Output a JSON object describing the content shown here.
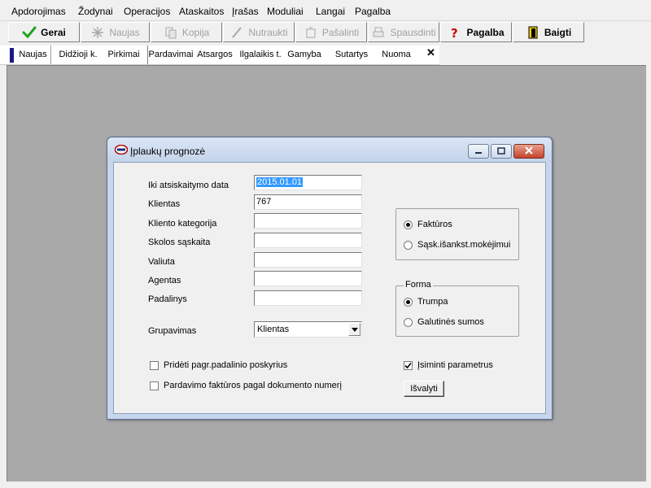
{
  "menu": {
    "items": [
      "Apdorojimas",
      "Žodynai",
      "Operacijos",
      "Ataskaitos",
      "Įrašas",
      "Moduliai",
      "Langai",
      "Pagalba"
    ]
  },
  "toolbar": {
    "buttons": [
      {
        "label": "Gerai",
        "icon": "check-icon",
        "enabled": true
      },
      {
        "label": "Naujas",
        "icon": "sparkle-icon",
        "enabled": false
      },
      {
        "label": "Kopija",
        "icon": "copy-icon",
        "enabled": false
      },
      {
        "label": "Nutraukti",
        "icon": "cancel-icon",
        "enabled": false
      },
      {
        "label": "Pašalinti",
        "icon": "delete-icon",
        "enabled": false
      },
      {
        "label": "Spausdinti",
        "icon": "print-icon",
        "enabled": false
      },
      {
        "label": "Pagalba",
        "icon": "help-icon",
        "enabled": true
      },
      {
        "label": "Baigti",
        "icon": "exit-door-icon",
        "enabled": true
      }
    ]
  },
  "tabs": {
    "items": [
      "Naujas",
      "Didžioji k.",
      "Pirkimai",
      "Pardavimai",
      "Atsargos",
      "Ilgalaikis t.",
      "Gamyba",
      "Sutartys",
      "Nuoma"
    ],
    "active": "Pardavimai",
    "close_label": "✕"
  },
  "dialog": {
    "title": "Įplaukų prognozė",
    "fields": {
      "date_label": "Iki atsiskaitymo data",
      "date_value": "2015.01.01",
      "client_label": "Klientas",
      "client_value": "767",
      "client_category_label": "Kliento kategorija",
      "client_category_value": "",
      "debt_account_label": "Skolos sąskaita",
      "debt_account_value": "",
      "currency_label": "Valiuta",
      "currency_value": "",
      "agent_label": "Agentas",
      "agent_value": "",
      "division_label": "Padalinys",
      "division_value": ""
    },
    "grouping_label": "Grupavimas",
    "grouping_value": "Klientas",
    "doc_type": {
      "options": [
        "Faktūros",
        "Sąsk.išankst.mokėjimui"
      ],
      "selected": 0
    },
    "form": {
      "legend": "Forma",
      "options": [
        "Trumpa",
        "Galutinės sumos"
      ],
      "selected": 0
    },
    "checkboxes": {
      "add_division_label": "Pridėti  pagr.padalinio poskyrius",
      "add_division_checked": false,
      "by_doc_number_label": "Pardavimo faktūros pagal dokumento numerį",
      "by_doc_number_checked": false,
      "remember_label": "Įsiminti parametrus",
      "remember_checked": true
    },
    "clear_button_label": "Išvalyti"
  },
  "colors": {
    "workspace": "#a9a9a9",
    "selection": "#3399ff",
    "tab_marker": "#1a1a8a"
  }
}
